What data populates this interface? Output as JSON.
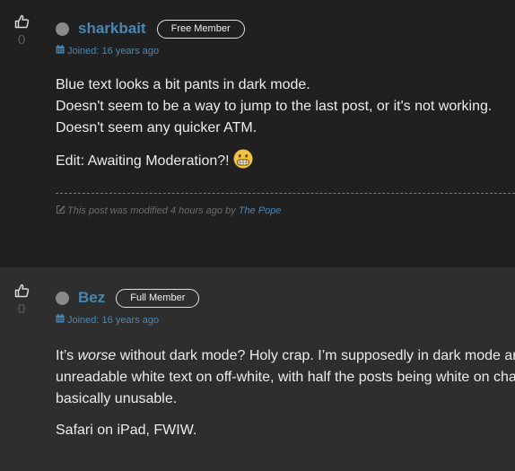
{
  "posts": [
    {
      "vote_count": "0",
      "username": "sharkbait",
      "badge": "Free Member",
      "joined": "Joined: 16 years ago",
      "lines": [
        "Blue text looks a bit pants in dark mode.",
        "Doesn't seem to be a way to jump to the last post, or it's not working.",
        "Doesn't seem any quicker ATM."
      ],
      "edit_text": "Edit: Awaiting Moderation?!",
      "modified_text": "This post was modified 4 hours ago by",
      "modified_by": "The Pope"
    },
    {
      "vote_count": "0",
      "username": "Bez",
      "badge": "Full Member",
      "joined": "Joined: 16 years ago",
      "line1_prefix": "It’s ",
      "line1_em": "worse",
      "line1_suffix": " without dark mode? Holy crap. I’m supposedly in dark mode an",
      "line2": "unreadable white text on off-white, with half the posts being white on cha",
      "line3": "basically unusable.",
      "para2": "Safari on iPad, FWIW."
    }
  ],
  "colors": {
    "link_blue": "#4a86b2",
    "post1_bg": "#202020",
    "post2_bg": "#2e2e2e"
  },
  "icons": [
    "thumbs-up-icon",
    "calendar-icon",
    "grimace-emoji-icon",
    "edit-icon"
  ]
}
